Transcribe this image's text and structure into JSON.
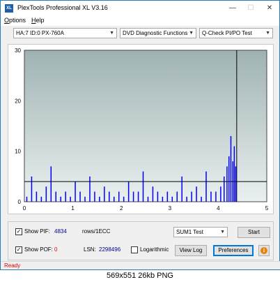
{
  "window": {
    "title": "PlexTools Professional XL V3.16",
    "icon_label": "XL",
    "min_glyph": "—",
    "max_glyph": "☐",
    "close_glyph": "✕"
  },
  "menu": {
    "options": {
      "first": "O",
      "rest": "ptions"
    },
    "help": {
      "first": "H",
      "rest": "elp"
    }
  },
  "selectors": {
    "drive": "HA:7 ID:0  PX-760A",
    "function": "DVD Diagnostic Functions",
    "test": "Q-Check PI/PO Test"
  },
  "chart_data": {
    "type": "bar",
    "xlim": [
      0,
      5
    ],
    "ylim": [
      0,
      30
    ],
    "x_ticks": [
      "0",
      "1",
      "2",
      "3",
      "4",
      "5"
    ],
    "y_ticks": [
      "0",
      "10",
      "20",
      "30"
    ],
    "threshold": 4,
    "end_marker_x": 4.38,
    "series": [
      {
        "color": "#0000ff",
        "x": [
          0.05,
          0.15,
          0.25,
          0.35,
          0.45,
          0.55,
          0.65,
          0.75,
          0.85,
          0.95,
          1.05,
          1.15,
          1.25,
          1.35,
          1.45,
          1.55,
          1.65,
          1.75,
          1.85,
          1.95,
          2.05,
          2.15,
          2.25,
          2.35,
          2.45,
          2.55,
          2.65,
          2.75,
          2.85,
          2.95,
          3.05,
          3.15,
          3.25,
          3.35,
          3.45,
          3.55,
          3.65,
          3.75,
          3.85,
          3.95,
          4.05,
          4.12,
          4.18,
          4.22,
          4.26,
          4.3,
          4.33,
          4.36
        ],
        "y": [
          1,
          5,
          2,
          1,
          3,
          7,
          2,
          1,
          2,
          1,
          4,
          2,
          1,
          5,
          2,
          1,
          3,
          2,
          1,
          2,
          1,
          4,
          2,
          2,
          6,
          1,
          3,
          2,
          1,
          2,
          1,
          2,
          5,
          1,
          2,
          3,
          1,
          6,
          2,
          2,
          3,
          5,
          7,
          9,
          13,
          8,
          11,
          7
        ]
      }
    ]
  },
  "controls": {
    "show_pif": {
      "label": "Show PIF:",
      "value": "4834",
      "unit": "rows/1ECC",
      "checked": "✓"
    },
    "show_pof": {
      "label": "Show POF:",
      "value": "0",
      "checked": "✓"
    },
    "lsn": {
      "label": "LSN:",
      "value": "2298496"
    },
    "logarithmic": {
      "label": "Logarithmic"
    },
    "sum_select": "SUM1 Test",
    "start": "Start",
    "view_log": "View Log",
    "preferences": "Preferences",
    "info": "i"
  },
  "status": "Ready",
  "footer": "569x551  26kb  PNG",
  "colors": {
    "accent": "#0078d7",
    "plot_bg_top": "#9fb2b2",
    "plot_bg_bottom": "#eaf0f0",
    "series": "#0000ff",
    "value_blue": "#00008b",
    "value_red": "#e00000"
  }
}
